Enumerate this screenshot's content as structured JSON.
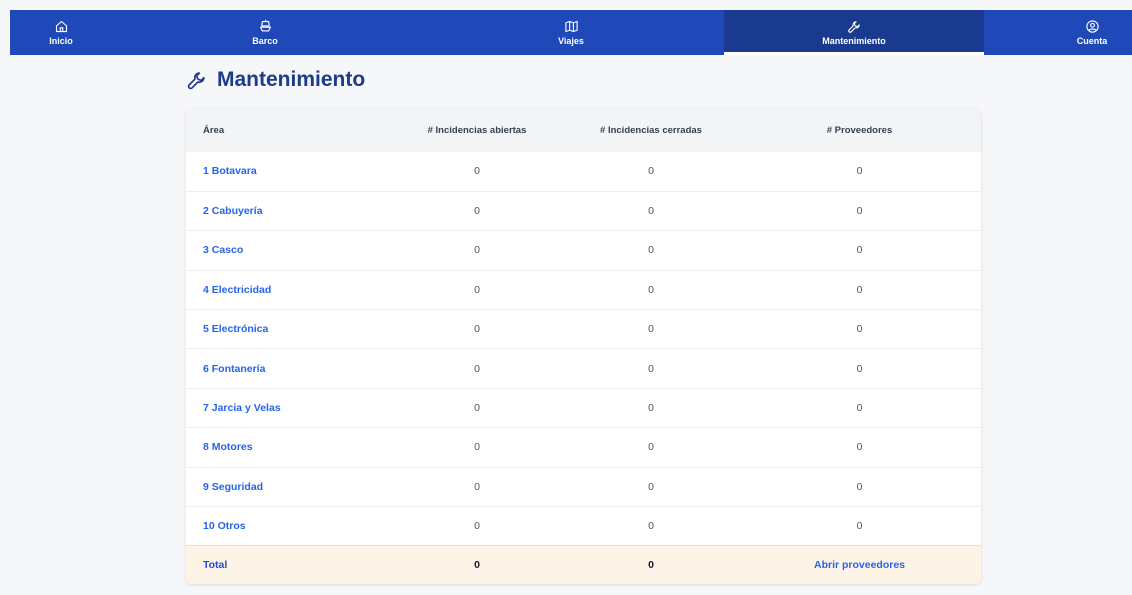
{
  "nav": {
    "inicio": "Inicio",
    "barco": "Barco",
    "viajes": "Viajes",
    "mantenimiento": "Mantenimiento",
    "cuenta": "Cuenta"
  },
  "page": {
    "title": "Mantenimiento"
  },
  "table": {
    "headers": {
      "area": "Área",
      "abiertas": "# Incidencias abiertas",
      "cerradas": "# Incidencias cerradas",
      "proveedores": "# Proveedores"
    },
    "rows": [
      {
        "area": "1 Botavara",
        "abiertas": "0",
        "cerradas": "0",
        "proveedores": "0"
      },
      {
        "area": "2 Cabuyería",
        "abiertas": "0",
        "cerradas": "0",
        "proveedores": "0"
      },
      {
        "area": "3 Casco",
        "abiertas": "0",
        "cerradas": "0",
        "proveedores": "0"
      },
      {
        "area": "4 Electricidad",
        "abiertas": "0",
        "cerradas": "0",
        "proveedores": "0"
      },
      {
        "area": "5 Electrónica",
        "abiertas": "0",
        "cerradas": "0",
        "proveedores": "0"
      },
      {
        "area": "6 Fontanería",
        "abiertas": "0",
        "cerradas": "0",
        "proveedores": "0"
      },
      {
        "area": "7 Jarcia y Velas",
        "abiertas": "0",
        "cerradas": "0",
        "proveedores": "0"
      },
      {
        "area": "8 Motores",
        "abiertas": "0",
        "cerradas": "0",
        "proveedores": "0"
      },
      {
        "area": "9 Seguridad",
        "abiertas": "0",
        "cerradas": "0",
        "proveedores": "0"
      },
      {
        "area": "10 Otros",
        "abiertas": "0",
        "cerradas": "0",
        "proveedores": "0"
      }
    ],
    "footer": {
      "label": "Total",
      "abiertas": "0",
      "cerradas": "0",
      "link": "Abrir proveedores"
    }
  },
  "icons": {
    "inicio": "home-icon",
    "barco": "boat-icon",
    "viajes": "map-icon",
    "mantenimiento": "wrench-icon",
    "cuenta": "user-circle-icon"
  },
  "colors": {
    "nav_bg": "#1f48b9",
    "nav_active": "#1a3a8f",
    "link": "#2563eb",
    "title": "#1e3a8a",
    "footer_bg": "#fdf4e7"
  }
}
